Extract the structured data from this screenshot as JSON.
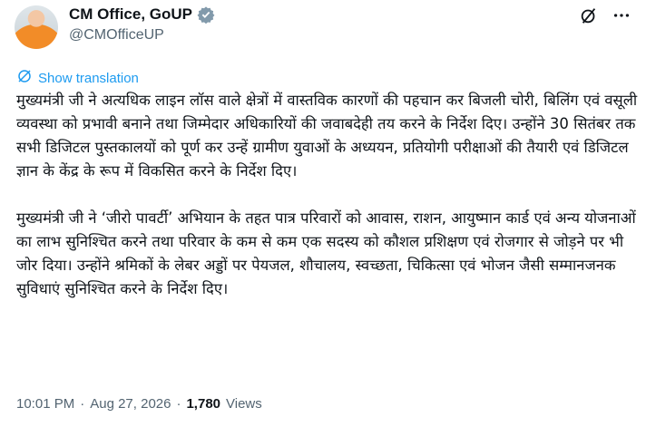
{
  "author": {
    "display_name": "CM Office, GoUP",
    "handle": "@CMOfficeUP"
  },
  "actions": {
    "grok_icon": "grok-icon",
    "more_icon": "more-icon"
  },
  "translate": {
    "label": "Show translation",
    "icon": "translate-icon"
  },
  "tweet": {
    "paragraph_1": "मुख्यमंत्री जी ने अत्यधिक लाइन लॉस वाले क्षेत्रों में वास्तविक कारणों की पहचान कर बिजली चोरी, बिलिंग एवं वसूली व्यवस्था को प्रभावी बनाने तथा जिम्मेदार अधिकारियों की जवाबदेही तय करने के निर्देश दिए। उन्होंने 30 सितंबर तक सभी डिजिटल पुस्तकालयों को पूर्ण कर उन्हें ग्रामीण युवाओं के अध्ययन, प्रतियोगी परीक्षाओं की तैयारी एवं डिजिटल ज्ञान के केंद्र के रूप में विकसित करने के निर्देश दिए।",
    "paragraph_2": "मुख्यमंत्री जी ने ‘जीरो पावर्टी’ अभियान के तहत पात्र परिवारों को आवास, राशन, आयुष्मान कार्ड एवं अन्य योजनाओं का लाभ सुनिश्चित करने तथा परिवार के कम से कम एक सदस्य को कौशल प्रशिक्षण एवं रोजगार से जोड़ने पर भी जोर दिया। उन्होंने श्रमिकों के लेबर अड्डों पर पेयजल, शौचालय, स्वच्छता, चिकित्सा एवं भोजन जैसी सम्मानजनक सुविधाएं सुनिश्चित करने के निर्देश दिए।"
  },
  "meta": {
    "time": "10:01 PM",
    "separator": "·",
    "date": "Aug 27, 2026",
    "views_count": "1,780",
    "views_label": "Views"
  },
  "colors": {
    "accent": "#1d9bf0",
    "verified": "#829aab",
    "muted": "#536471"
  }
}
